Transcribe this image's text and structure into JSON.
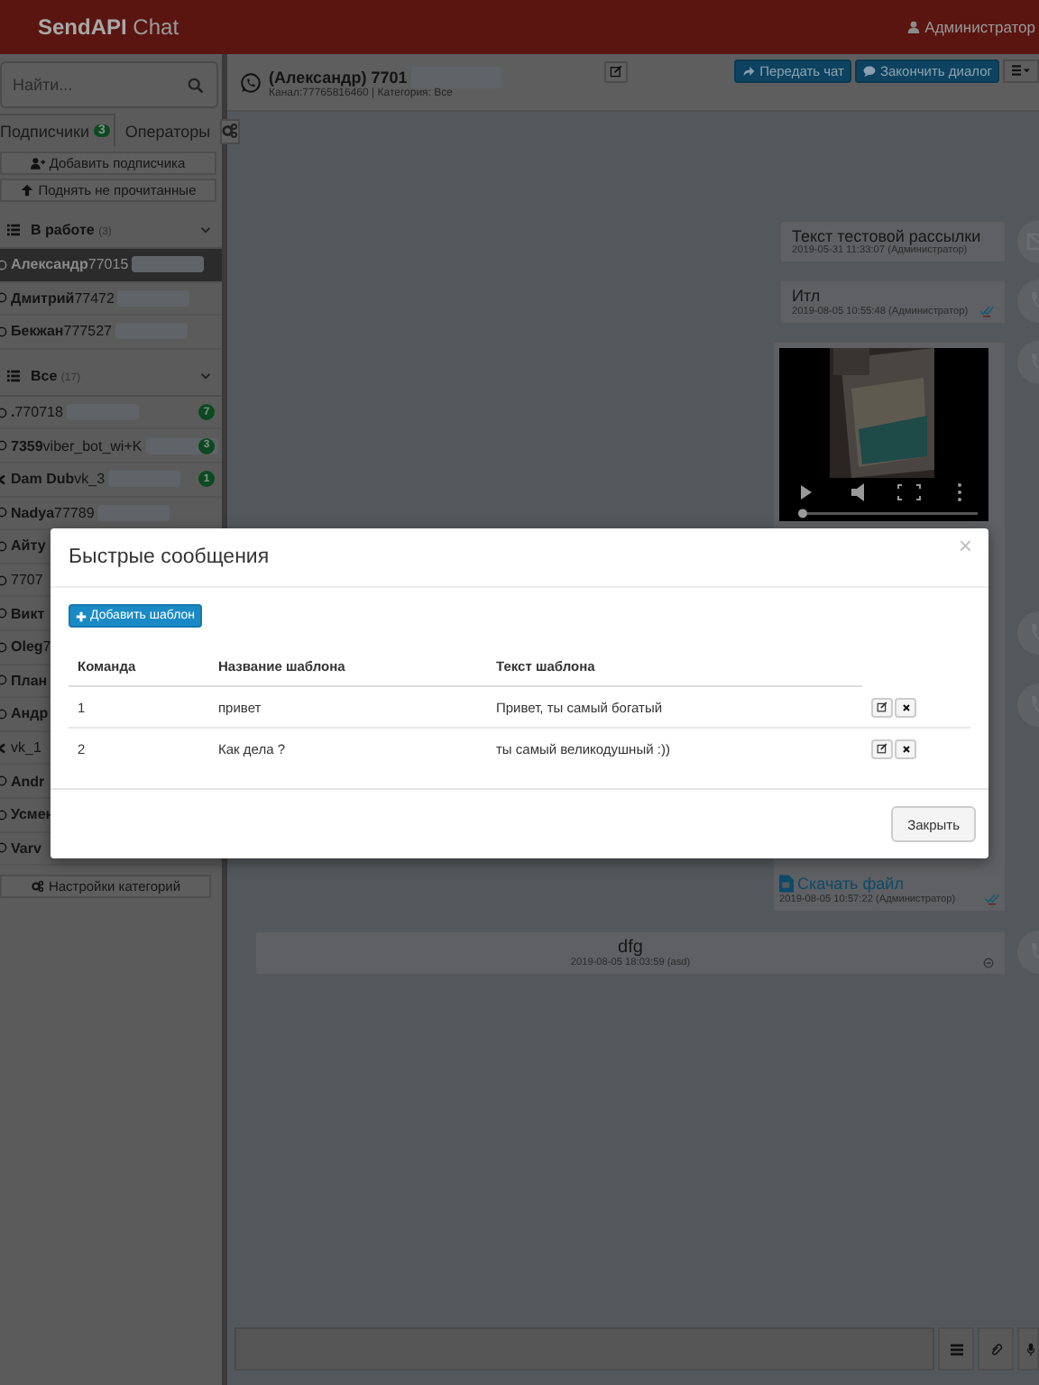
{
  "header": {
    "brand_bold": "SendAPI",
    "brand_light": "Chat",
    "user": "Администратор"
  },
  "sidebar": {
    "search": {
      "placeholder": "Найти..."
    },
    "tabs": [
      {
        "label": "Подписчики",
        "badge": "3",
        "selected": true
      },
      {
        "label": "Операторы",
        "selected": false
      }
    ],
    "actions": [
      "Добавить подписчика",
      "Поднять не прочитанные"
    ],
    "sections": [
      {
        "title": "В работе",
        "count": "(3)",
        "expanded": true,
        "items": [
          {
            "name": "Александр",
            "number": "77015",
            "kind": "chat",
            "selected": true,
            "redacted": true
          },
          {
            "name": "Дмитрий",
            "number": "77472",
            "kind": "chat",
            "selected": false,
            "redacted": true
          },
          {
            "name": "Бекжан",
            "number": "777527",
            "kind": "chat",
            "selected": false,
            "redacted": true
          }
        ]
      },
      {
        "title": "Все",
        "count": "(17)",
        "expanded": true,
        "items": [
          {
            "name": ".",
            "number": "770718",
            "kind": "chat",
            "selected": false,
            "badge": "7",
            "redacted": true
          },
          {
            "name": "7359",
            "number": "viber_bot_wi+K",
            "kind": "chat",
            "selected": false,
            "badge": "3",
            "redacted": true
          },
          {
            "name": "Dam Dub",
            "number": "vk_3",
            "kind": "vk",
            "selected": false,
            "badge": "1",
            "redacted": true
          },
          {
            "name": "Nadya",
            "number": "77789",
            "kind": "chat",
            "selected": false,
            "redacted": true
          },
          {
            "name": "Айту",
            "kind": "chat",
            "selected": false
          },
          {
            "number": "7707",
            "kind": "chat",
            "selected": false
          },
          {
            "name": "Викт",
            "kind": "chat",
            "selected": false
          },
          {
            "name": "Oleg",
            "number": "7",
            "kind": "chat",
            "selected": false
          },
          {
            "name": "План",
            "kind": "chat",
            "selected": false
          },
          {
            "name": "Андр",
            "kind": "chat",
            "selected": false
          },
          {
            "number": "vk_1",
            "kind": "vk",
            "selected": false
          },
          {
            "name": "Andr",
            "kind": "chat",
            "selected": false
          },
          {
            "name": "Усмен",
            "kind": "chat",
            "selected": false
          },
          {
            "name": "Varv",
            "kind": "chat",
            "selected": false
          }
        ]
      }
    ],
    "settings_button": "Настройки категорий"
  },
  "chat": {
    "contact": "(Александр) 7701",
    "contact_redacted": true,
    "meta": "Канал:77765816460 | Категория: Все",
    "buttons": [
      "Передать чат",
      "Закончить диалог"
    ],
    "messages": [
      {
        "kind": "text",
        "text": "Текст тестовой рассылки",
        "meta": "2019-05-31 11:33:07 (Администратор)",
        "avatar": {
          "kind": "mail"
        },
        "delivered": false
      },
      {
        "kind": "text",
        "text": "Итл",
        "meta": "2019-08-05 10:55:48 (Администратор)",
        "avatar": {
          "kind": "phone"
        },
        "delivered": true
      },
      {
        "kind": "video",
        "link": "Скачать файл",
        "meta": "2019-08-05 10:57:22 (Администратор)",
        "avatar": {
          "kind": "phone"
        },
        "delivered": true,
        "covered_avatars": [
          {
            "kind": "phone"
          },
          {
            "kind": "phone"
          }
        ]
      },
      {
        "kind": "wide",
        "text": "dfg",
        "meta": "2019-08-05 18:03:59 (asd)",
        "avatar": {
          "kind": "phone"
        },
        "delivered": false
      }
    ]
  },
  "modal": {
    "title": "Быстрые сообщения",
    "close": "×",
    "add_button": "Добавить шаблон",
    "columns": [
      "Команда",
      "Название шаблона",
      "Текст шаблона"
    ],
    "rows": [
      [
        "1",
        "привет",
        "Привет, ты самый богатый"
      ],
      [
        "2",
        "Как дела ?",
        "ты самый великодушный :))"
      ]
    ],
    "footer_button": "Закрыть"
  }
}
